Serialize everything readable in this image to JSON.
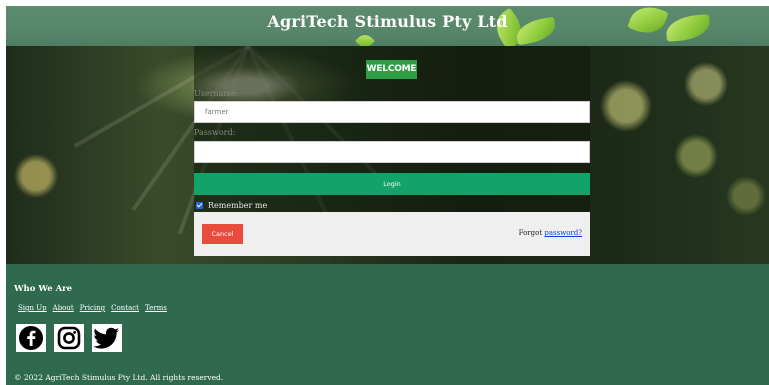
{
  "header": {
    "title": "AgriTech Stimulus Pty Ltd"
  },
  "login": {
    "welcome_label": "WELCOME",
    "username_label": "Username:",
    "username_value": "farmer",
    "password_label": "Password:",
    "password_value": "",
    "login_label": "Login",
    "remember_checked": true,
    "remember_label": "Remember me",
    "cancel_label": "Cancel",
    "forgot_prefix": "Forgot",
    "forgot_link": "password?"
  },
  "footer": {
    "heading": "Who We Are",
    "links": [
      "Sign Up",
      "About",
      "Pricing",
      "Contact",
      "Terms"
    ],
    "social_icons": [
      "facebook-icon",
      "instagram-icon",
      "twitter-icon"
    ],
    "copyright": "© 2022 AgriTech Stimulus Pty Ltd. All rights reserved."
  },
  "colors": {
    "page_green": "#2f6a4f",
    "welcome_green": "#2e9e46",
    "login_green": "#13a36a",
    "cancel_red": "#e94b3c",
    "link_blue": "#1a3fd6"
  }
}
